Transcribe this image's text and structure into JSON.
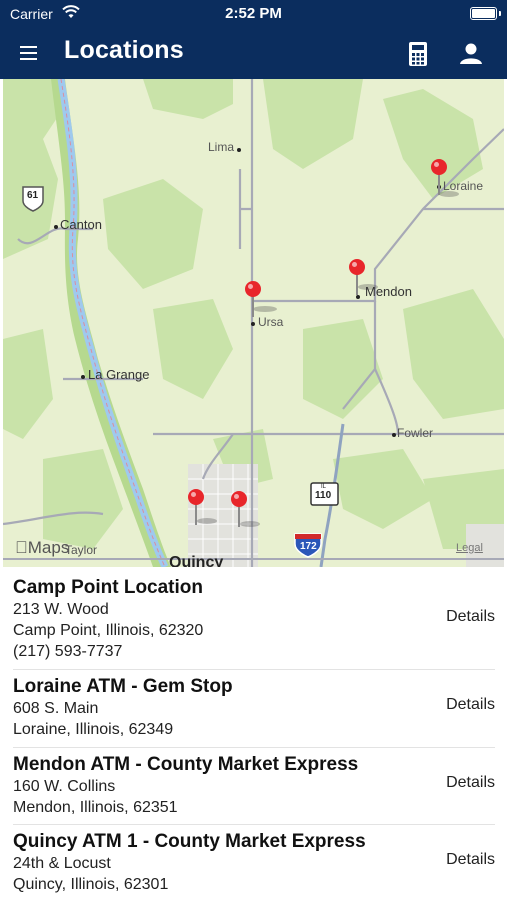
{
  "status_bar": {
    "carrier": "Carrier",
    "time": "2:52 PM"
  },
  "nav": {
    "title": "Locations"
  },
  "map": {
    "labels": {
      "lima": "Lima",
      "canton": "Canton",
      "loraine": "Loraine",
      "mendon": "Mendon",
      "ursa": "Ursa",
      "la_grange": "La Grange",
      "fowler": "Fowler",
      "quincy": "Quincy",
      "taylor": "Taylor",
      "route_61": "61",
      "route_110": "110",
      "route_172": "172",
      "route_il": "IL"
    },
    "maps_logo": "Maps",
    "legal": "Legal"
  },
  "locations": [
    {
      "name": "Camp Point Location",
      "address": "213 W. Wood",
      "city": "Camp Point, Illinois, 62320",
      "phone": "(217) 593-7737",
      "details": "Details"
    },
    {
      "name": "Loraine ATM - Gem Stop",
      "address": "608 S. Main",
      "city": "Loraine, Illinois, 62349",
      "details": "Details"
    },
    {
      "name": "Mendon ATM - County Market Express",
      "address": "160 W. Collins",
      "city": "Mendon, Illinois, 62351",
      "details": "Details"
    },
    {
      "name": "Quincy ATM 1 - County Market Express",
      "address": "24th & Locust",
      "city": "Quincy, Illinois, 62301",
      "details": "Details"
    }
  ],
  "colors": {
    "nav_bg": "#0b2d5e",
    "map_land": "#e8f0d0",
    "map_forest": "#c8e3a8",
    "river": "#9fc9ee",
    "pin": "#e8262b"
  }
}
